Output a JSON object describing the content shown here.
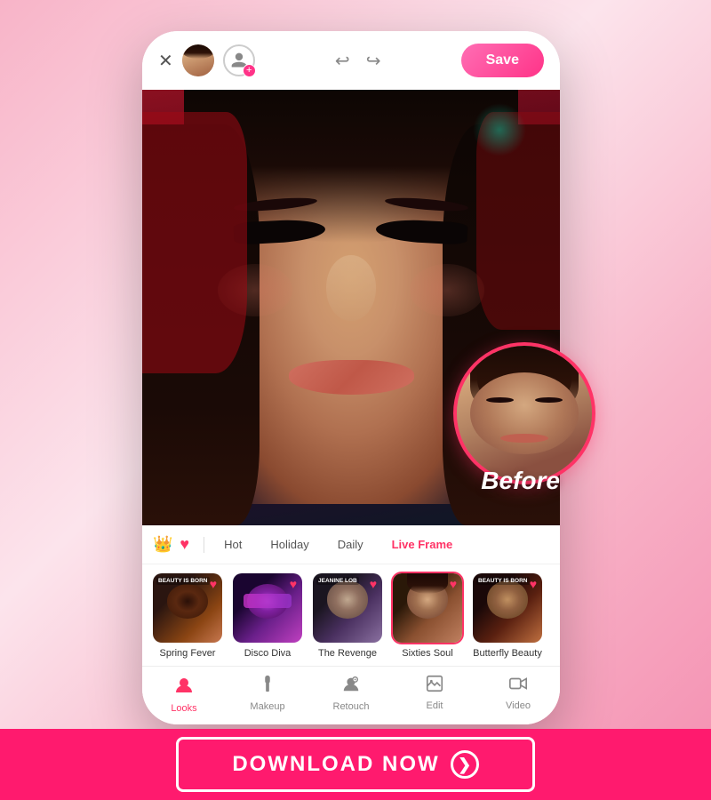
{
  "background": {
    "gradient": "linear-gradient(135deg, #f8b4c8, #fce4ec, #f8b4c8, #f48fb1)"
  },
  "topbar": {
    "close_label": "✕",
    "save_label": "Save",
    "undo_label": "↩",
    "redo_label": "↪"
  },
  "tabs": {
    "items": [
      {
        "id": "crown",
        "label": "👑",
        "type": "icon"
      },
      {
        "id": "heart",
        "label": "♥",
        "type": "icon"
      },
      {
        "id": "hot",
        "label": "Hot"
      },
      {
        "id": "holiday",
        "label": "Holiday"
      },
      {
        "id": "daily",
        "label": "Daily"
      },
      {
        "id": "liveframe",
        "label": "Live Frame"
      }
    ]
  },
  "filters": [
    {
      "id": "spring-fever",
      "label": "Spring Fever",
      "badge": "BEAUTY IS BORN",
      "color": "#3d1a0a",
      "heart": true,
      "selected": false
    },
    {
      "id": "disco-diva",
      "label": "Disco Diva",
      "badge": "",
      "color": "#2a0a40",
      "heart": true,
      "selected": false
    },
    {
      "id": "the-revenge",
      "label": "The Revenge",
      "badge": "jeanine lob",
      "color": "#252030",
      "heart": true,
      "selected": false
    },
    {
      "id": "sixties-soul",
      "label": "Sixties Soul",
      "badge": "",
      "color": "#3d2010",
      "heart": true,
      "selected": true
    },
    {
      "id": "butterfly-beauty",
      "label": "Butterfly Beauty",
      "badge": "BEAUTY IS BORN",
      "color": "#2a0f08",
      "heart": true,
      "selected": false
    }
  ],
  "bottom_nav": [
    {
      "id": "looks",
      "label": "Looks",
      "icon": "👤",
      "active": true
    },
    {
      "id": "makeup",
      "label": "Makeup",
      "icon": "💄",
      "active": false
    },
    {
      "id": "retouch",
      "label": "Retouch",
      "icon": "✨",
      "active": false
    },
    {
      "id": "edit",
      "label": "Edit",
      "icon": "🖼",
      "active": false
    },
    {
      "id": "video",
      "label": "Video",
      "icon": "▶",
      "active": false
    }
  ],
  "before_label": "Before",
  "download": {
    "label": "DOWNLOAD NOW",
    "arrow": "❯"
  }
}
